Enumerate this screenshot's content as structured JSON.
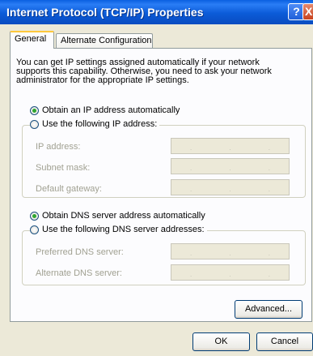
{
  "window": {
    "title": "Internet Protocol (TCP/IP) Properties",
    "help_glyph": "?",
    "close_glyph": "X"
  },
  "tabs": [
    {
      "label": "General",
      "active": true
    },
    {
      "label": "Alternate Configuration",
      "active": false
    }
  ],
  "description": "You can get IP settings assigned automatically if your network supports this capability. Otherwise, you need to ask your network administrator for the appropriate IP settings.",
  "ip": {
    "auto_label": "Obtain an IP address automatically",
    "auto_selected": true,
    "manual_label": "Use the following IP address:",
    "manual_selected": false,
    "fields": [
      {
        "label": "IP address:",
        "value": ""
      },
      {
        "label": "Subnet mask:",
        "value": ""
      },
      {
        "label": "Default gateway:",
        "value": ""
      }
    ]
  },
  "dns": {
    "auto_label": "Obtain DNS server address automatically",
    "auto_selected": true,
    "manual_label": "Use the following DNS server addresses:",
    "manual_selected": false,
    "fields": [
      {
        "label": "Preferred DNS server:",
        "value": ""
      },
      {
        "label": "Alternate DNS server:",
        "value": ""
      }
    ]
  },
  "buttons": {
    "advanced": "Advanced...",
    "ok": "OK",
    "cancel": "Cancel"
  },
  "ip_dot": "."
}
